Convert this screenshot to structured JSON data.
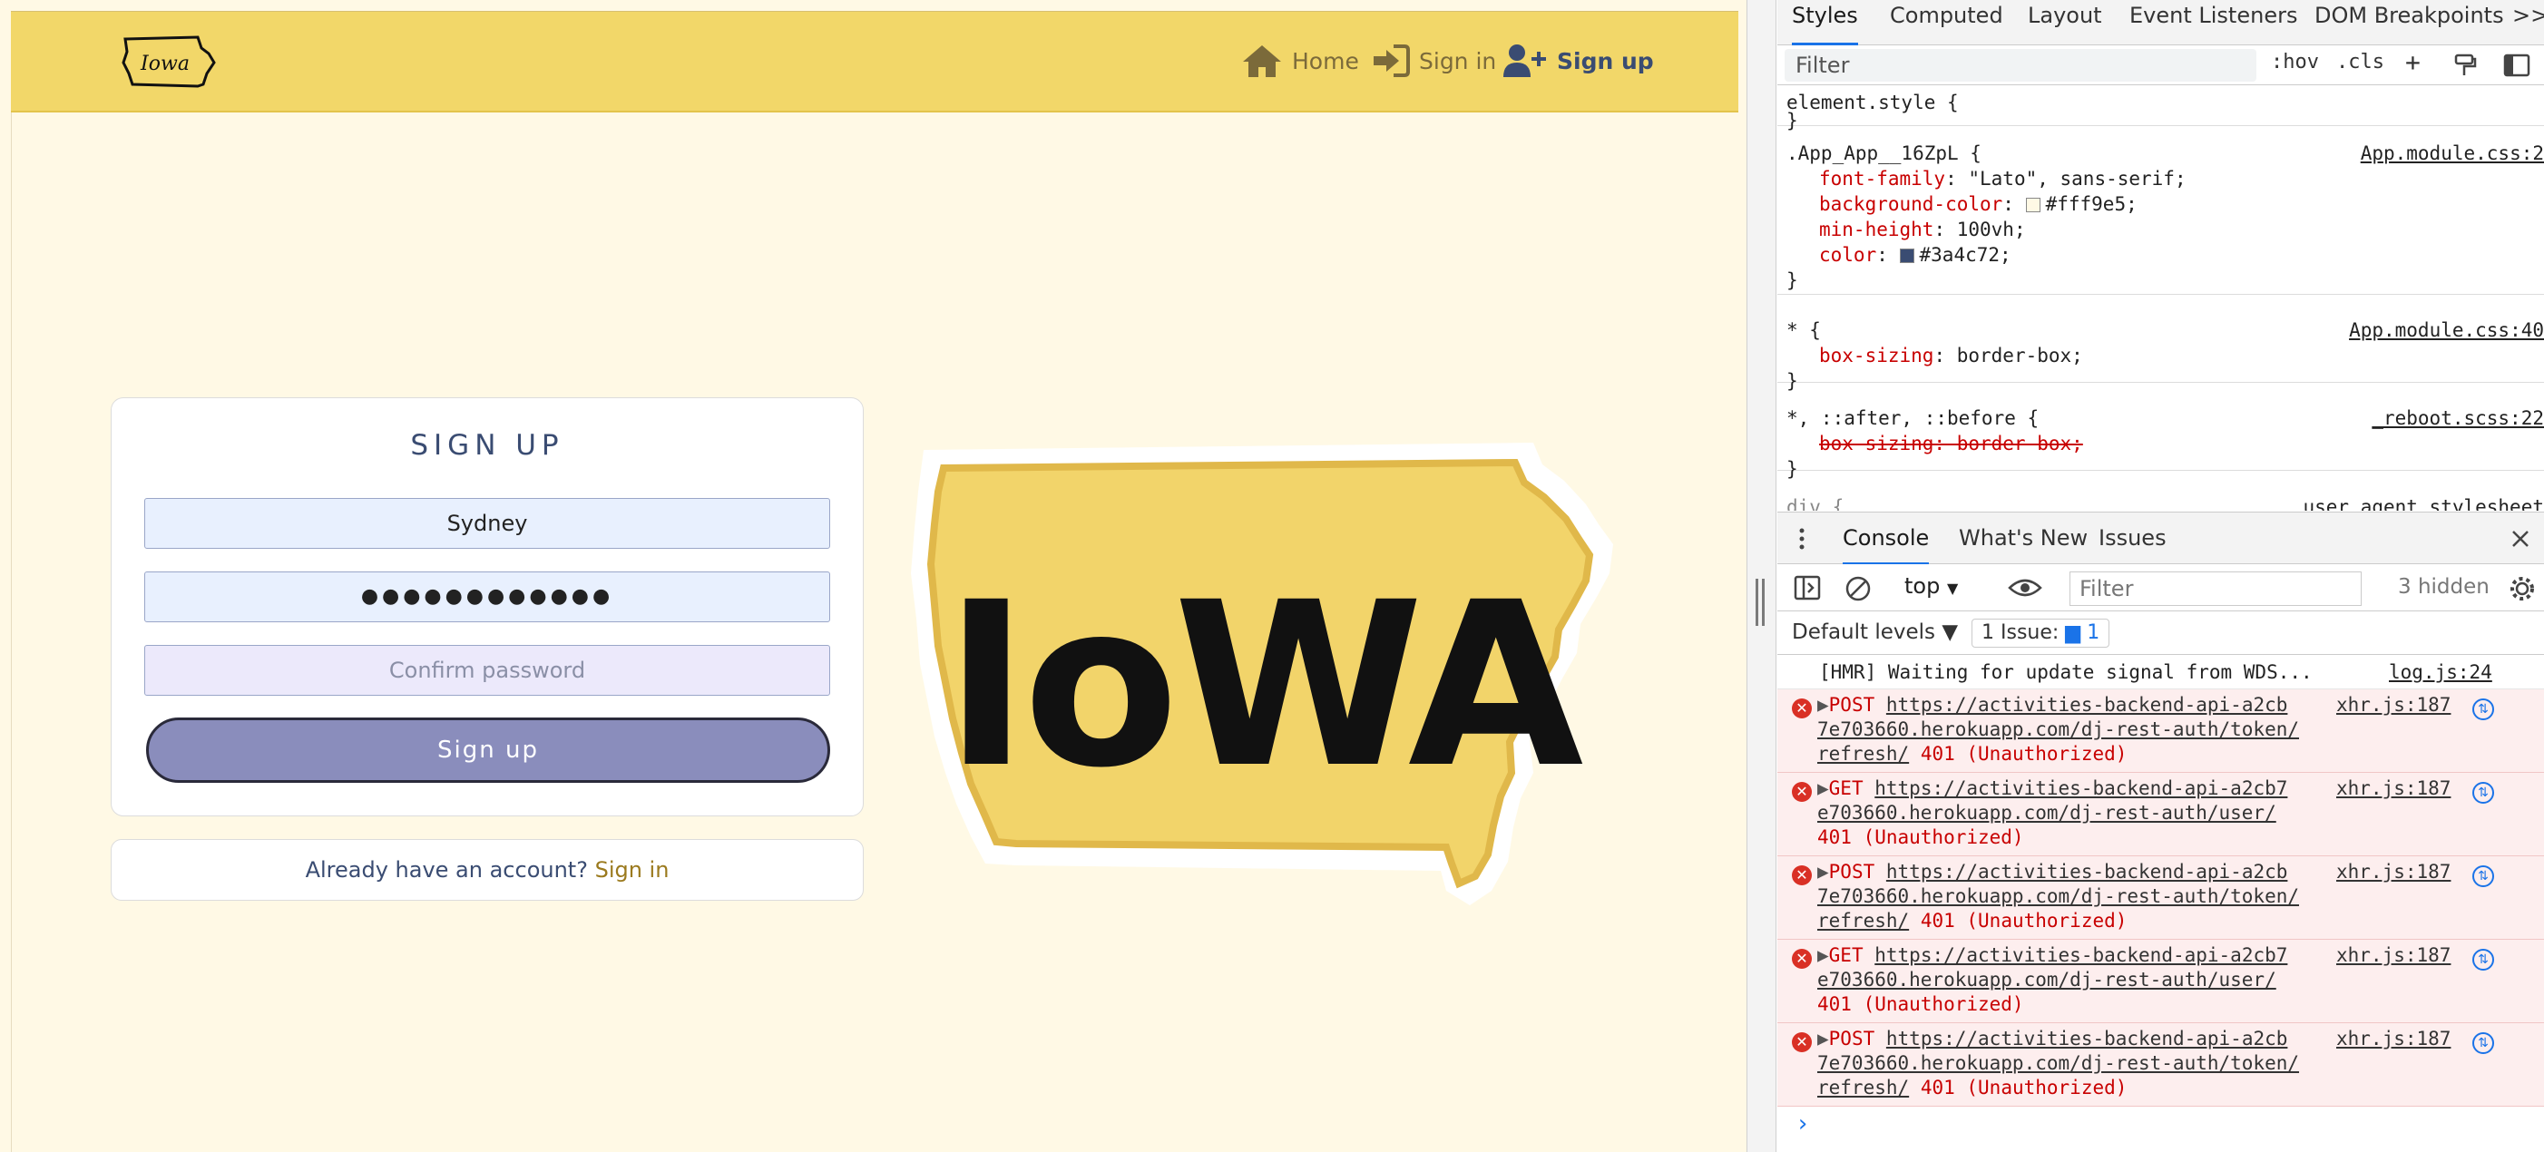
{
  "app": {
    "logo_text": "Iowa",
    "nav": {
      "home": "Home",
      "sign_in": "Sign in",
      "sign_up": "Sign up"
    },
    "signup_form": {
      "title": "SIGN UP",
      "username_value": "Sydney",
      "password_masked": "●●●●●●●●●●●●",
      "confirm_placeholder": "Confirm password",
      "submit_label": "Sign up"
    },
    "signin_prompt": {
      "text": "Already have an account? ",
      "link": "Sign in"
    },
    "hero_image_text": "IoWA",
    "colors": {
      "background": "#fff9e5",
      "navbar": "#f2d769",
      "text": "#3a4c72",
      "button": "#8a8dbc"
    }
  },
  "devtools": {
    "tabs": [
      "Styles",
      "Computed",
      "Layout",
      "Event Listeners",
      "DOM Breakpoints"
    ],
    "overflow_icon": ">>",
    "styles_filter_placeholder": "Filter",
    "hov": ":hov",
    "cls": ".cls",
    "rules": {
      "element_selector": "element.style {",
      "app_selector": ".App_App__16ZpL {",
      "app_source": "App.module.css:2",
      "font_family_prop": "font-family",
      "font_family_val": "\"Lato\", sans-serif;",
      "bg_prop": "background-color",
      "bg_val": "#fff9e5;",
      "minh_prop": "min-height",
      "minh_val": "100vh;",
      "color_prop": "color",
      "color_val": "#3a4c72;",
      "star_selector": "* {",
      "star_source": "App.module.css:40",
      "boxsizing_prop": "box-sizing",
      "boxsizing_val": "border-box;",
      "pseudo_selector": "*, ::after, ::before {",
      "pseudo_source": "_reboot.scss:22",
      "boxsizing_struck": "box-sizing: border-box;",
      "div_selector": "div {",
      "div_source": "user agent stylesheet",
      "close_brace": "}"
    },
    "drawer_tabs": [
      "Console",
      "What's New",
      "Issues"
    ],
    "context": "top",
    "console_filter_placeholder": "Filter",
    "hidden_count": "3 hidden",
    "default_levels": "Default levels ▼",
    "issues_badge": "1 Issue:",
    "issues_count": "1",
    "logs": [
      {
        "type": "info",
        "text": "[HMR] Waiting for update signal from WDS...",
        "source": "log.js:24"
      },
      {
        "type": "error",
        "method": "POST",
        "url": "https://activities-backend-api-a2cb7e703660.herokuapp.com/dj-rest-auth/token/refresh/",
        "line1": "https://activities-backend-api-a2cb",
        "line2": "7e703660.herokuapp.com/dj-rest-auth/token/",
        "line3": "refresh/",
        "status": "401 (Unauthorized)",
        "source": "xhr.js:187"
      },
      {
        "type": "error",
        "method": "GET",
        "url": "https://activities-backend-api-a2cb7e703660.herokuapp.com/dj-rest-auth/user/",
        "line1": "https://activities-backend-api-a2cb7",
        "line2": "e703660.herokuapp.com/dj-rest-auth/user/",
        "line3": "",
        "status": "401 (Unauthorized)",
        "source": "xhr.js:187"
      },
      {
        "type": "error",
        "method": "POST",
        "url": "https://activities-backend-api-a2cb7e703660.herokuapp.com/dj-rest-auth/token/refresh/",
        "line1": "https://activities-backend-api-a2cb",
        "line2": "7e703660.herokuapp.com/dj-rest-auth/token/",
        "line3": "refresh/",
        "status": "401 (Unauthorized)",
        "source": "xhr.js:187"
      },
      {
        "type": "error",
        "method": "GET",
        "url": "https://activities-backend-api-a2cb7e703660.herokuapp.com/dj-rest-auth/user/",
        "line1": "https://activities-backend-api-a2cb7",
        "line2": "e703660.herokuapp.com/dj-rest-auth/user/",
        "line3": "",
        "status": "401 (Unauthorized)",
        "source": "xhr.js:187"
      },
      {
        "type": "error",
        "method": "POST",
        "url": "https://activities-backend-api-a2cb7e703660.herokuapp.com/dj-rest-auth/token/refresh/",
        "line1": "https://activities-backend-api-a2cb",
        "line2": "7e703660.herokuapp.com/dj-rest-auth/token/",
        "line3": "refresh/",
        "status": "401 (Unauthorized)",
        "source": "xhr.js:187"
      }
    ],
    "prompt": "›"
  }
}
